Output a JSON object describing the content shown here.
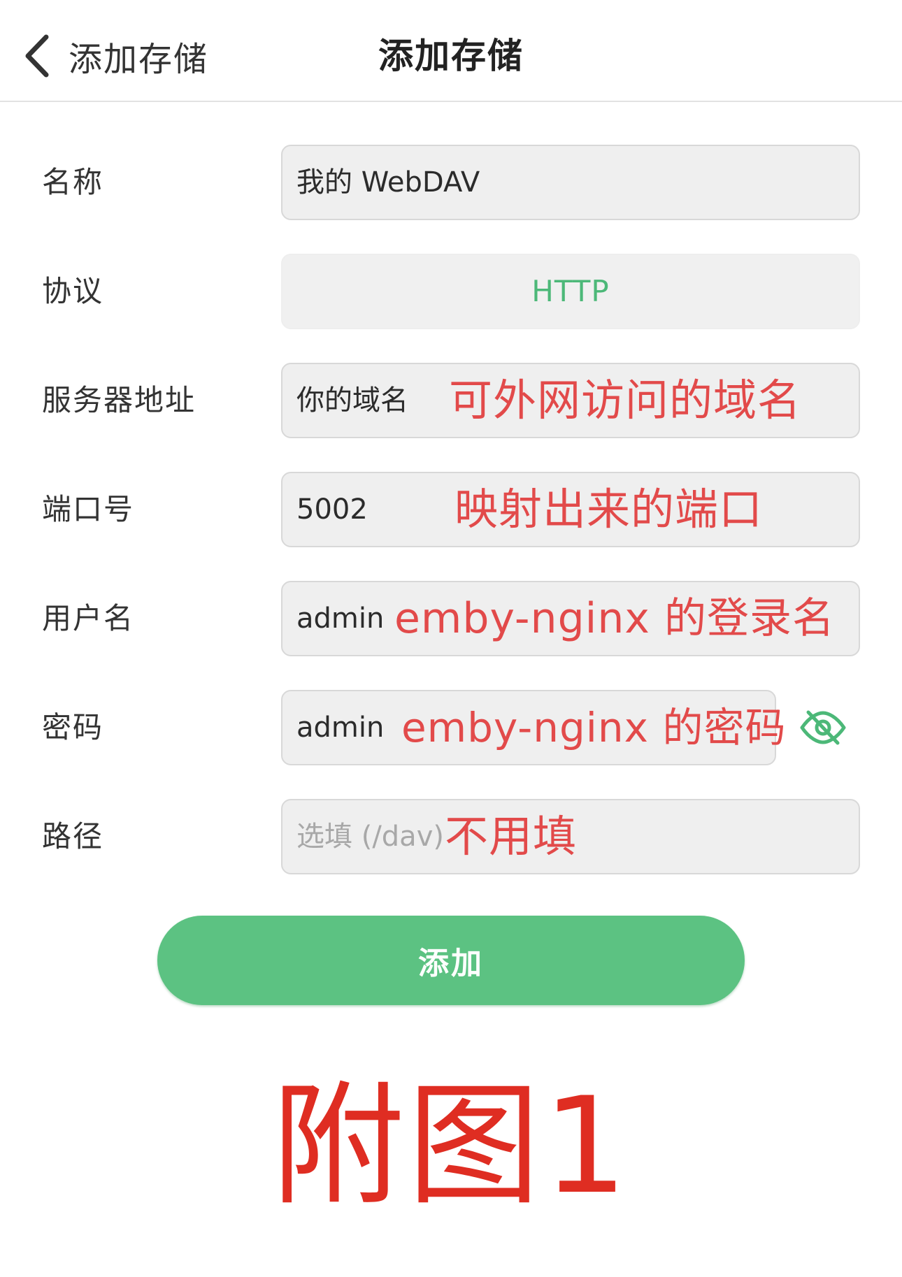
{
  "navbar": {
    "back_label": "添加存储",
    "title": "添加存储"
  },
  "form": {
    "name": {
      "label": "名称",
      "value": "我的 WebDAV"
    },
    "protocol": {
      "label": "协议",
      "value": "HTTP"
    },
    "server": {
      "label": "服务器地址",
      "value": "你的域名",
      "note": "可外网访问的域名"
    },
    "port": {
      "label": "端口号",
      "value": "5002",
      "note": "映射出来的端口"
    },
    "username": {
      "label": "用户名",
      "value": "admin",
      "note": "emby-nginx 的登录名"
    },
    "password": {
      "label": "密码",
      "value": "admin",
      "note": "emby-nginx 的密码"
    },
    "path": {
      "label": "路径",
      "placeholder": "选填 (/dav)",
      "note": "不用填"
    }
  },
  "submit_label": "添加",
  "caption": "附图1",
  "colors": {
    "accent": "#5cc282",
    "protocol_text": "#4cb878",
    "annotation": "#e24a4a",
    "caption": "#df2d22"
  },
  "icons": {
    "back": "chevron-left-icon",
    "password_toggle": "eye-slash-icon"
  }
}
